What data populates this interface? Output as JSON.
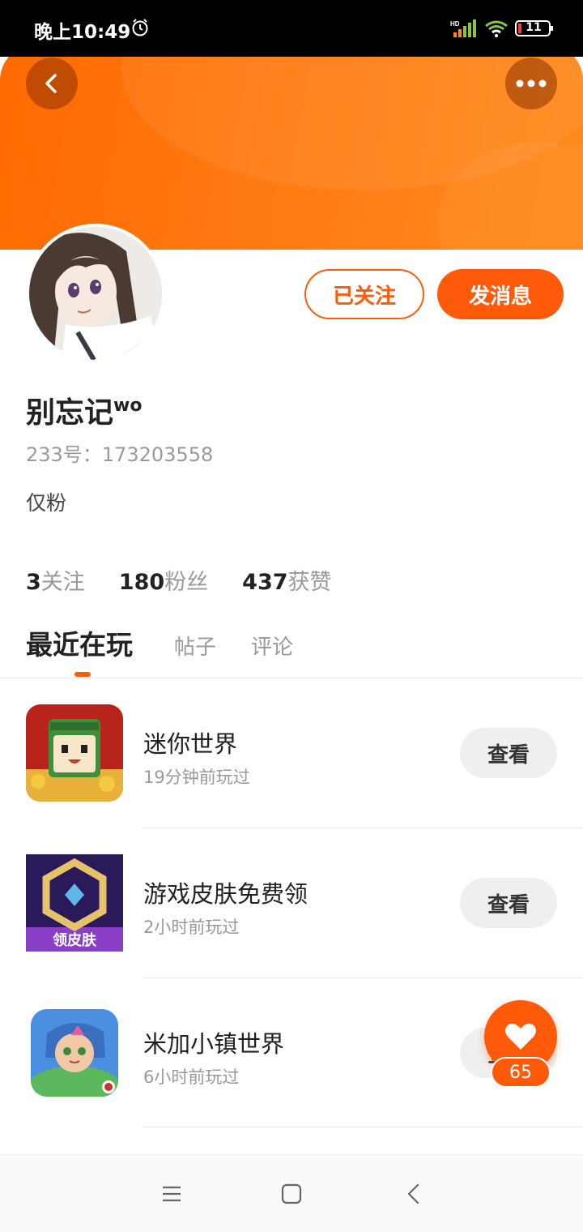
{
  "status_bar": {
    "time": "晚上10:49",
    "battery": "11"
  },
  "profile": {
    "username": "别忘记",
    "username_suffix": "wo",
    "uid": "233号：173203558",
    "bio": "仅粉",
    "followed_label": "已关注",
    "message_label": "发消息"
  },
  "stats": [
    {
      "value": "3",
      "label": "关注"
    },
    {
      "value": "180",
      "label": "粉丝"
    },
    {
      "value": "437",
      "label": "获赞"
    }
  ],
  "tabs": [
    {
      "label": "最近在玩",
      "active": true
    },
    {
      "label": "帖子",
      "active": false
    },
    {
      "label": "评论",
      "active": false
    }
  ],
  "games": [
    {
      "name": "迷你世界",
      "time": "19分钟前玩过",
      "action": "查看"
    },
    {
      "name": "游戏皮肤免费领",
      "time": "2小时前玩过",
      "action": "查看",
      "icon_text": "领皮肤"
    },
    {
      "name": "米加小镇世界",
      "time": "6小时前玩过",
      "action": "查看"
    }
  ],
  "like": {
    "count": "65"
  },
  "colors": {
    "accent": "#ff5a0a",
    "banner": "#ff7a12"
  }
}
